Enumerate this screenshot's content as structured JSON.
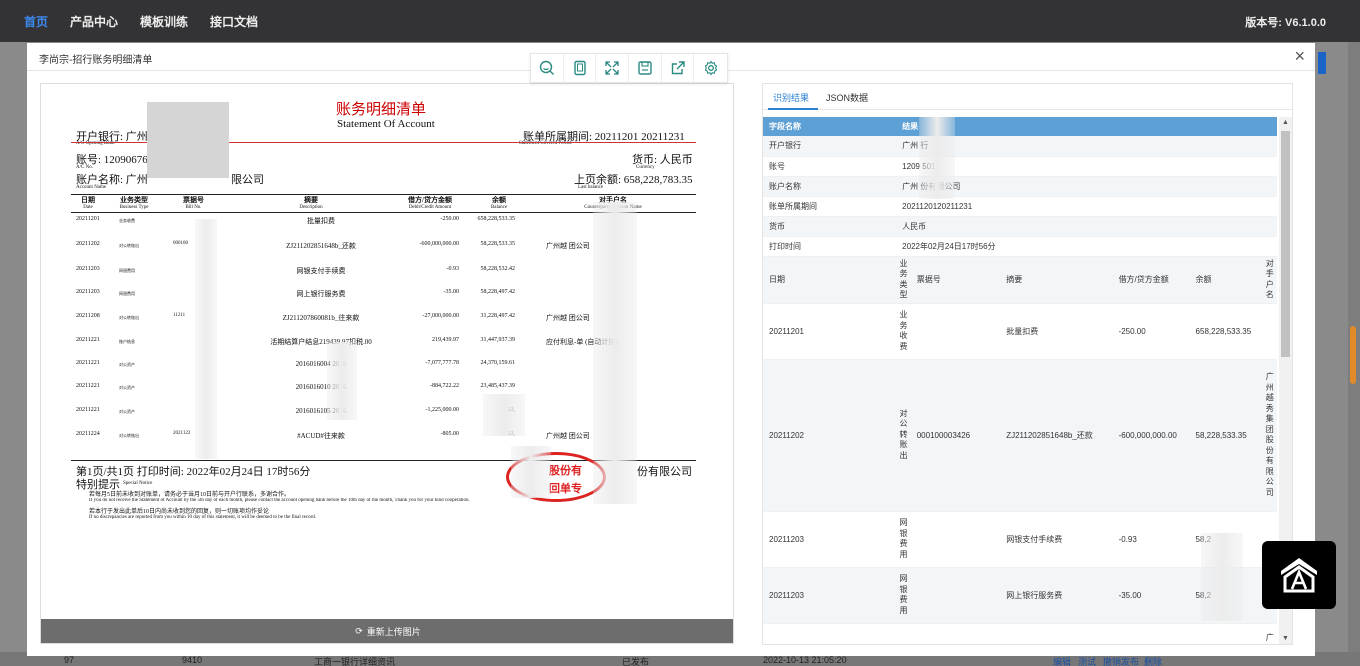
{
  "nav": {
    "items": [
      "首页",
      "产品中心",
      "模板训练",
      "接口文档"
    ],
    "version": "版本号: V6.1.0.0"
  },
  "background_row": {
    "id": "97",
    "code": "9410",
    "name": "工商一银行详细资讯",
    "status": "已发布",
    "time": "2022-10-13 21:05:20",
    "actions": [
      "编辑",
      "测试",
      "撤销发布",
      "删除"
    ]
  },
  "modal": {
    "title": "李尚宗-招行账务明细清单",
    "reupload": "重新上传图片",
    "toolbar_icons": [
      "zoom-icon",
      "fit-page-icon",
      "fullscreen-icon",
      "save-icon",
      "export-icon",
      "settings-icon"
    ]
  },
  "doc": {
    "title_cn": "账务明细清单",
    "title_en": "Statement Of Account",
    "bank_label": "开户银行: 广州",
    "bank_en": "A/C Opening Bank",
    "period_label": "账单所属期间: 20211201  20211231",
    "period_en": "Statement Covered Period",
    "acct_label": "账号: 12090676",
    "acct_en": "A/C No.",
    "currency_label": "货币: 人民币",
    "currency_en": "Currency",
    "name_label": "账户名称: 广州",
    "name_tail": "限公司",
    "name_en": "Account Name",
    "last_balance": "上页余额: 658,228,783.35",
    "last_balance_en": "Last balance",
    "headers": [
      {
        "cn": "日期",
        "en": "Date"
      },
      {
        "cn": "业务类型",
        "en": "Business Type"
      },
      {
        "cn": "票据号",
        "en": "Bill No."
      },
      {
        "cn": "摘要",
        "en": "Description"
      },
      {
        "cn": "借方/贷方金额",
        "en": "Debit/Credit Amount"
      },
      {
        "cn": "余额",
        "en": "Balance"
      },
      {
        "cn": "对手户名",
        "en": "Counterparty Account Name"
      }
    ],
    "rows": [
      {
        "d": "20211201",
        "bt": "业务收费",
        "bn": "",
        "ds": "批量扣费",
        "am": "-250.00",
        "bl": "658,228,533.35",
        "cp": ""
      },
      {
        "d": "20211202",
        "bt": "对公转账出",
        "bn": "000100",
        "ds": "ZJ211202851648b_还款",
        "am": "-600,000,000.00",
        "bl": "58,228,533.35",
        "cp": "广州越                        团公司"
      },
      {
        "d": "20211203",
        "bt": "网银费用",
        "bn": "",
        "ds": "网银支付手续费",
        "am": "-0.93",
        "bl": "58,228,532.42",
        "cp": ""
      },
      {
        "d": "20211203",
        "bt": "网银费用",
        "bn": "",
        "ds": "网上银行服务费",
        "am": "-35.00",
        "bl": "58,228,497.42",
        "cp": ""
      },
      {
        "d": "20211208",
        "bt": "对公转账出",
        "bn": "11211",
        "ds": "ZJ211207860081b_往来款",
        "am": "-27,000,000.00",
        "bl": "31,228,497.42",
        "cp": "广州越                        团公司"
      },
      {
        "d": "20211221",
        "bt": "账户结息",
        "bn": "",
        "ds": "活期结算户结息219439.97扣税.00",
        "am": "219,439.97",
        "bl": "31,447,937.39",
        "cp": "应付利息-单              (自动计提)"
      },
      {
        "d": "20211221",
        "bt": "对公资产",
        "bn": "",
        "ds": "2016016004 2016",
        "am": "-7,077,777.78",
        "bl": "24,370,159.61",
        "cp": ""
      },
      {
        "d": "20211221",
        "bt": "对公资产",
        "bn": "",
        "ds": "2016016010 2016",
        "am": "-884,722.22",
        "bl": "23,485,437.39",
        "cp": ""
      },
      {
        "d": "20211221",
        "bt": "对公资产",
        "bn": "",
        "ds": "2016016105 2016",
        "am": "-1,225,000.00",
        "bl": "22,",
        "cp": ""
      },
      {
        "d": "20211224",
        "bt": "对公转账出",
        "bn": "2021122",
        "ds": "#ACUD#往来款",
        "am": "-805.00",
        "bl": "22,",
        "cp": "广州越                        团公司"
      }
    ],
    "footer_page": "第1页/共1页  打印时间: 2022年02月24日 17时56分",
    "footer_company": "份有限公司",
    "notice_title": "特别提示",
    "notice_en_title": "Special Notice",
    "notice_lines": [
      "若每月5日前未收到对账单，请务必于当月10日前与开户行联系，多谢合作。",
      "If you do not receive the Statement of Account by the 5th day of each month, please contact the account opening bank before the 10th day of the month, Thank you for your kind cooperation.",
      "若本行于发出此单后10日内尚未收到您的回复，则一切账项均作妥论",
      "If no discrepancies are reported from you within 10 day of this statement, it will be deemed to be the final record."
    ],
    "stamp_text": "股份有\n回单专"
  },
  "result": {
    "tabs": [
      "识别结果",
      "JSON数据"
    ],
    "headers": [
      "字段名称",
      "结果"
    ],
    "fields": [
      {
        "name": "开户银行",
        "value": "广州              行"
      },
      {
        "name": "账号",
        "value": "1209              501"
      },
      {
        "name": "账户名称",
        "value": "广州              份有限公司"
      },
      {
        "name": "账单所属期间",
        "value": "2021120120211231"
      },
      {
        "name": "货币",
        "value": "人民币"
      },
      {
        "name": "打印时间",
        "value": "2022年02月24日17时56分"
      }
    ],
    "table_headers": {
      "date": "日期",
      "type": "业务类型",
      "bill": "票据号",
      "desc": "摘要",
      "amount": "借方/贷方金额",
      "balance": "余额",
      "counter": "对手户名"
    },
    "table_rows": [
      {
        "date": "20211201",
        "type": "业务收费",
        "bill": "",
        "desc": "批量扣费",
        "amount": "-250.00",
        "balance": "658,228,533.35",
        "counter": ""
      },
      {
        "date": "20211202",
        "type": "对公转账出",
        "bill": "000100003426",
        "desc": "ZJ211202851648b_还款",
        "amount": "-600,000,000.00",
        "balance": "58,228,533.35",
        "counter": "广州越秀集团股份有限公司"
      },
      {
        "date": "20211203",
        "type": "网银费用",
        "bill": "",
        "desc": "网银支付手续费",
        "amount": "-0.93",
        "balance": "58,2",
        "counter": ""
      },
      {
        "date": "20211203",
        "type": "网银费用",
        "bill": "",
        "desc": "网上银行服务费",
        "amount": "-35.00",
        "balance": "58,2",
        "counter": ""
      },
      {
        "date": "",
        "type": "",
        "bill": "",
        "desc": "",
        "amount": "",
        "balance": "",
        "counter": "广"
      }
    ]
  },
  "colors": {
    "nav_bg": "#333335",
    "accent": "#3d8bf2",
    "table_header": "#5da0d6",
    "stamp": "#dd2222"
  }
}
